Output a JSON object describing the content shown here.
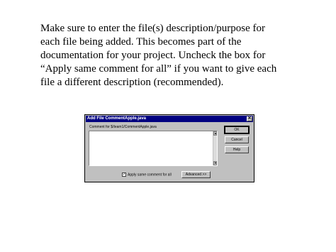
{
  "slide": {
    "lines": [
      "Make sure to enter the file(s) description/purpose for",
      "each file being added.  This becomes part of the",
      "documentation for your project.  Uncheck the box for",
      "“Apply same comment for all” if you want to give each",
      "file a different description (recommended)."
    ]
  },
  "dialog": {
    "title": "Add File CommentApple.java",
    "close_glyph": "✕",
    "comment_label": "Comment for $/team1/CommentApple.java",
    "comment_value": "",
    "checkbox_label": "Apply same comment for all",
    "checkbox_checked": true,
    "checkbox_glyph": "✓",
    "buttons": {
      "ok": "OK",
      "cancel": "Cancel",
      "help": "Help",
      "advanced": "Advanced >>"
    }
  },
  "colors": {
    "titlebar": "#000080",
    "dialog_face": "#c0c0c0"
  }
}
